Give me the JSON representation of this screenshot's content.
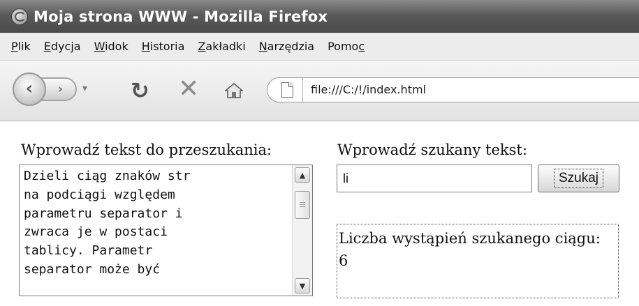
{
  "window": {
    "title": "Moja strona WWW - Mozilla Firefox",
    "app_icon": "firefox-icon"
  },
  "menu": {
    "items": [
      {
        "label": "Plik",
        "accel": "P"
      },
      {
        "label": "Edycja",
        "accel": "E"
      },
      {
        "label": "Widok",
        "accel": "W"
      },
      {
        "label": "Historia",
        "accel": "H"
      },
      {
        "label": "Zakładki",
        "accel": "Z"
      },
      {
        "label": "Narzędzia",
        "accel": "N"
      },
      {
        "label": "Pomoc",
        "accel": "c"
      }
    ]
  },
  "toolbar": {
    "icons": [
      "back-icon",
      "forward-icon",
      "history-dropdown-icon",
      "reload-icon",
      "stop-icon",
      "home-icon",
      "page-icon"
    ],
    "address": "file:///C:/!/index.html"
  },
  "page": {
    "source_label": "Wprowadź tekst do przeszukania:",
    "source_lines": [
      "Dzieli ciąg znaków str",
      "na podciągi względem",
      "parametru separator i",
      "zwraca je w postaci",
      "tablicy. Parametr",
      "separator może być"
    ],
    "search_label": "Wprowadź szukany tekst:",
    "search_value": "li",
    "search_button": "Szukaj",
    "result_label": "Liczba wystąpień szukanego ciągu:",
    "result_value": "6"
  },
  "colors": {
    "titlebar": "#5a5a5a",
    "menubar": "#ececec",
    "page_background": "#ffffff"
  }
}
